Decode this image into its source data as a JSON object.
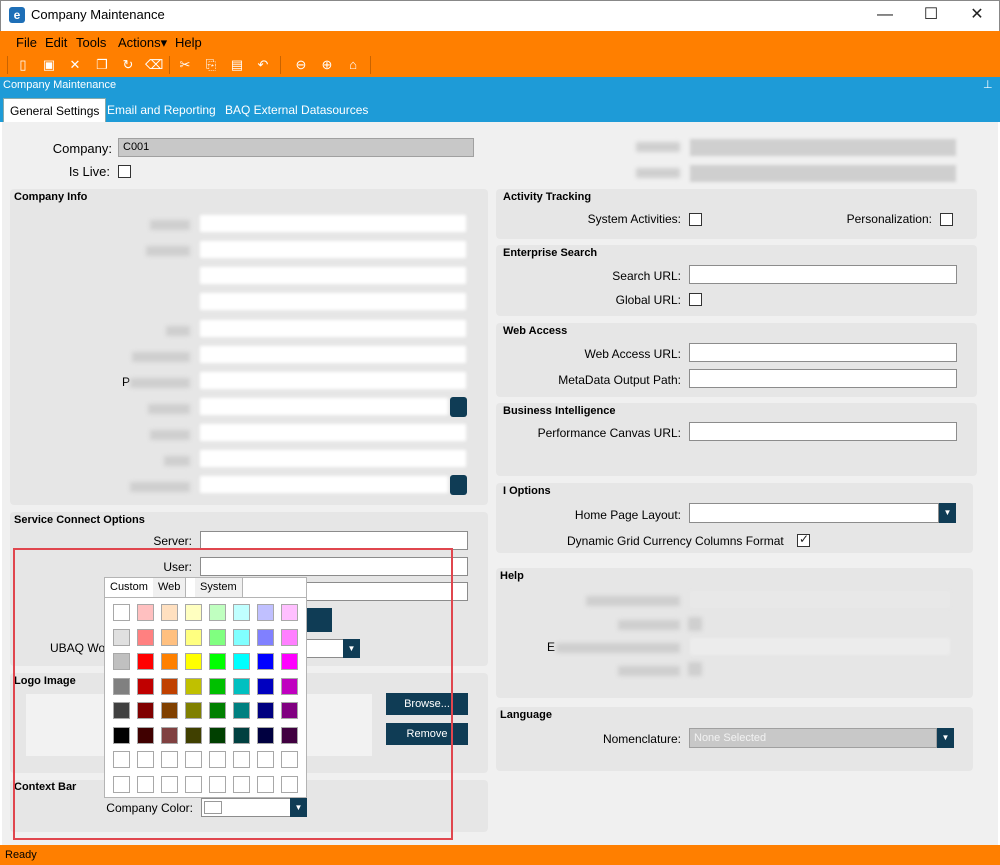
{
  "window": {
    "title": "Company Maintenance",
    "minimize": "—",
    "maximize": "☐",
    "close": "✕"
  },
  "menu": [
    "File",
    "Edit",
    "Tools",
    "Actions▾",
    "Help"
  ],
  "form_header": "Company Maintenance",
  "pin": "⊥",
  "tabs": [
    "General Settings",
    "Email and Reporting",
    "BAQ External Datasources"
  ],
  "company": {
    "label": "Company:",
    "value": "C001",
    "is_live_label": "Is Live:"
  },
  "company_info": {
    "title": "Company Info",
    "postal_label_partial": "P"
  },
  "activity_tracking": {
    "title": "Activity Tracking",
    "system_activities": "System Activities:",
    "personalization": "Personalization:"
  },
  "enterprise_search": {
    "title": "Enterprise Search",
    "search_url": "Search URL:",
    "global_url": "Global URL:"
  },
  "web_access": {
    "title": "Web Access",
    "web_access_url": "Web Access URL:",
    "metadata_output_path": "MetaData Output Path:"
  },
  "business_intelligence": {
    "title": "Business Intelligence",
    "performance_canvas_url": "Performance Canvas URL:"
  },
  "ui_options": {
    "title": "I Options",
    "home_page_layout": "Home Page Layout:",
    "dynamic_grid": "Dynamic Grid Currency Columns Format"
  },
  "help": {
    "title": "Help",
    "partial_label": "E"
  },
  "language": {
    "title": "Language",
    "nomenclature": "Nomenclature:",
    "nomenclature_value": "None Selected"
  },
  "service_connect": {
    "title": "Service Connect Options",
    "server": "Server:",
    "user": "User:",
    "ubaq_label": "UBAQ Wo"
  },
  "logo_image": {
    "title": "Logo Image",
    "browse": "Browse...",
    "remove": "Remove"
  },
  "context_bar": {
    "title": "Context Bar",
    "company_color": "Company Color:"
  },
  "color_picker": {
    "tabs": [
      "Custom",
      "Web",
      "System"
    ],
    "rows": [
      [
        "#ffffff",
        "#ffc0c0",
        "#ffe0c0",
        "#ffffc0",
        "#c0ffc0",
        "#c0ffff",
        "#c0c0ff",
        "#ffc0ff"
      ],
      [
        "#e0e0e0",
        "#ff8080",
        "#ffc080",
        "#ffff80",
        "#80ff80",
        "#80ffff",
        "#8080ff",
        "#ff80ff"
      ],
      [
        "#c0c0c0",
        "#ff0000",
        "#ff8000",
        "#ffff00",
        "#00ff00",
        "#00ffff",
        "#0000ff",
        "#ff00ff"
      ],
      [
        "#808080",
        "#c00000",
        "#c04000",
        "#c0c000",
        "#00c000",
        "#00c0c0",
        "#0000c0",
        "#c000c0"
      ],
      [
        "#404040",
        "#800000",
        "#804000",
        "#808000",
        "#008000",
        "#008080",
        "#000080",
        "#800080"
      ],
      [
        "#000000",
        "#400000",
        "#804040",
        "#404000",
        "#004000",
        "#004040",
        "#000040",
        "#400040"
      ],
      [
        "#ffffff",
        "#ffffff",
        "#ffffff",
        "#ffffff",
        "#ffffff",
        "#ffffff",
        "#ffffff",
        "#ffffff"
      ],
      [
        "#ffffff",
        "#ffffff",
        "#ffffff",
        "#ffffff",
        "#ffffff",
        "#ffffff",
        "#ffffff",
        "#ffffff"
      ]
    ]
  },
  "status": "Ready",
  "colors": {
    "accent": "#ff7f00",
    "header": "#1e9bd7",
    "highlight": "#e0464e"
  }
}
